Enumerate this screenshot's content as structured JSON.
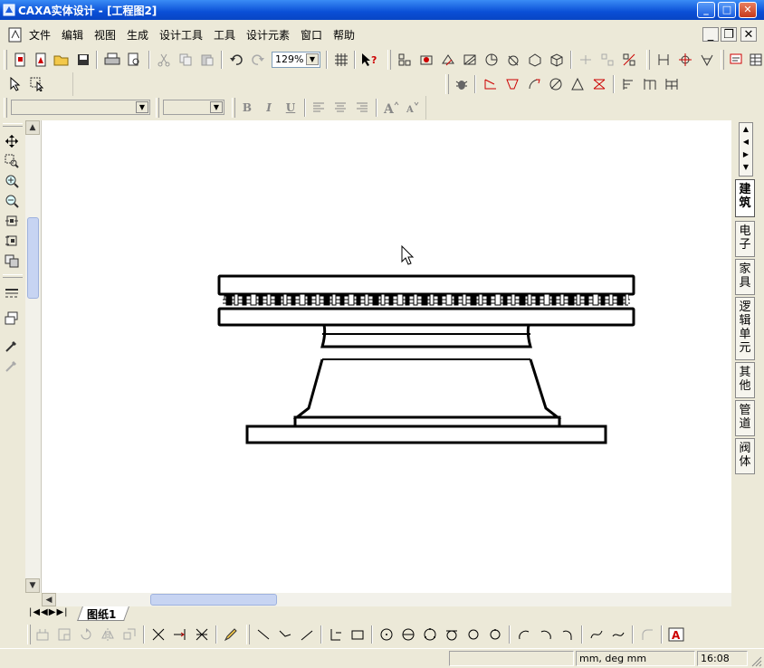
{
  "window": {
    "title": "CAXA实体设计 - [工程图2]",
    "minimize_label": "_",
    "maximize_label": "□",
    "close_label": "✕"
  },
  "menu": {
    "items": [
      "文件",
      "编辑",
      "视图",
      "生成",
      "设计工具",
      "工具",
      "设计元素",
      "窗口",
      "帮助"
    ],
    "mdi_minimize": "_",
    "mdi_restore": "❐",
    "mdi_close": "✕"
  },
  "toolbar": {
    "zoom_value": "129%",
    "bold_label": "B",
    "italic_label": "I",
    "underline_label": "U"
  },
  "right_tabs": [
    "建筑",
    "电子",
    "家具",
    "逻辑单元",
    "其他",
    "管道",
    "阀体"
  ],
  "sheet": {
    "tab_label": "图纸1"
  },
  "status": {
    "units": "mm, deg   mm",
    "time": "16:08"
  },
  "colors": {
    "title_bar": "#0a4fd6",
    "chrome": "#ece9d8",
    "canvas": "#ffffff"
  }
}
